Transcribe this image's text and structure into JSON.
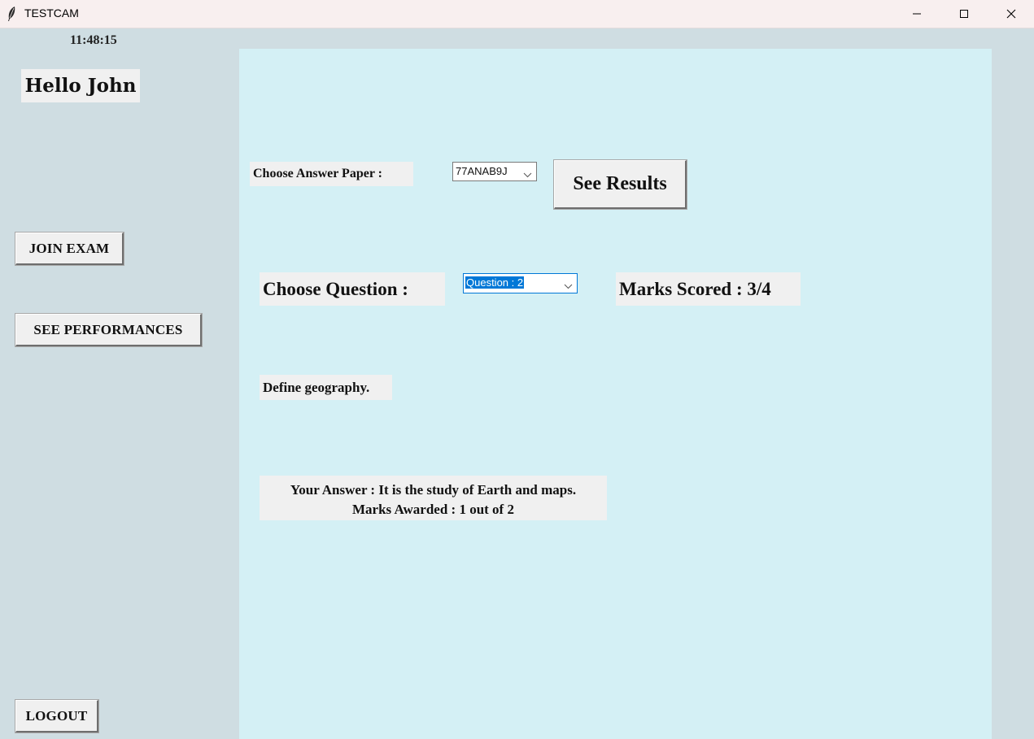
{
  "window": {
    "title": "TESTCAM",
    "app_icon": "feather-icon",
    "controls": [
      "minimize-icon",
      "maximize-icon",
      "close-icon"
    ]
  },
  "sidebar": {
    "clock": "11:48:15",
    "greeting": "Hello John",
    "join_exam_label": "JOIN EXAM",
    "see_performances_label": "SEE PERFORMANCES",
    "logout_label": "LOGOUT"
  },
  "main": {
    "answer_paper_label": "Choose Answer Paper :",
    "answer_paper_selected": "77ANAB9J",
    "see_results_label": "See Results",
    "question_label": "Choose Question :",
    "question_selected": "Question : 2",
    "marks_scored": "Marks Scored : 3/4",
    "question_text": "Define geography.",
    "your_answer": "Your Answer : It is the study of Earth and maps.",
    "marks_awarded": "Marks Awarded : 1 out of 2"
  },
  "colors": {
    "window_bg": "#cfdde2",
    "panel_bg": "#d4f0f5",
    "label_bg": "#f0f0f0",
    "selection": "#0078d7",
    "titlebar_bg": "#f8efef"
  }
}
